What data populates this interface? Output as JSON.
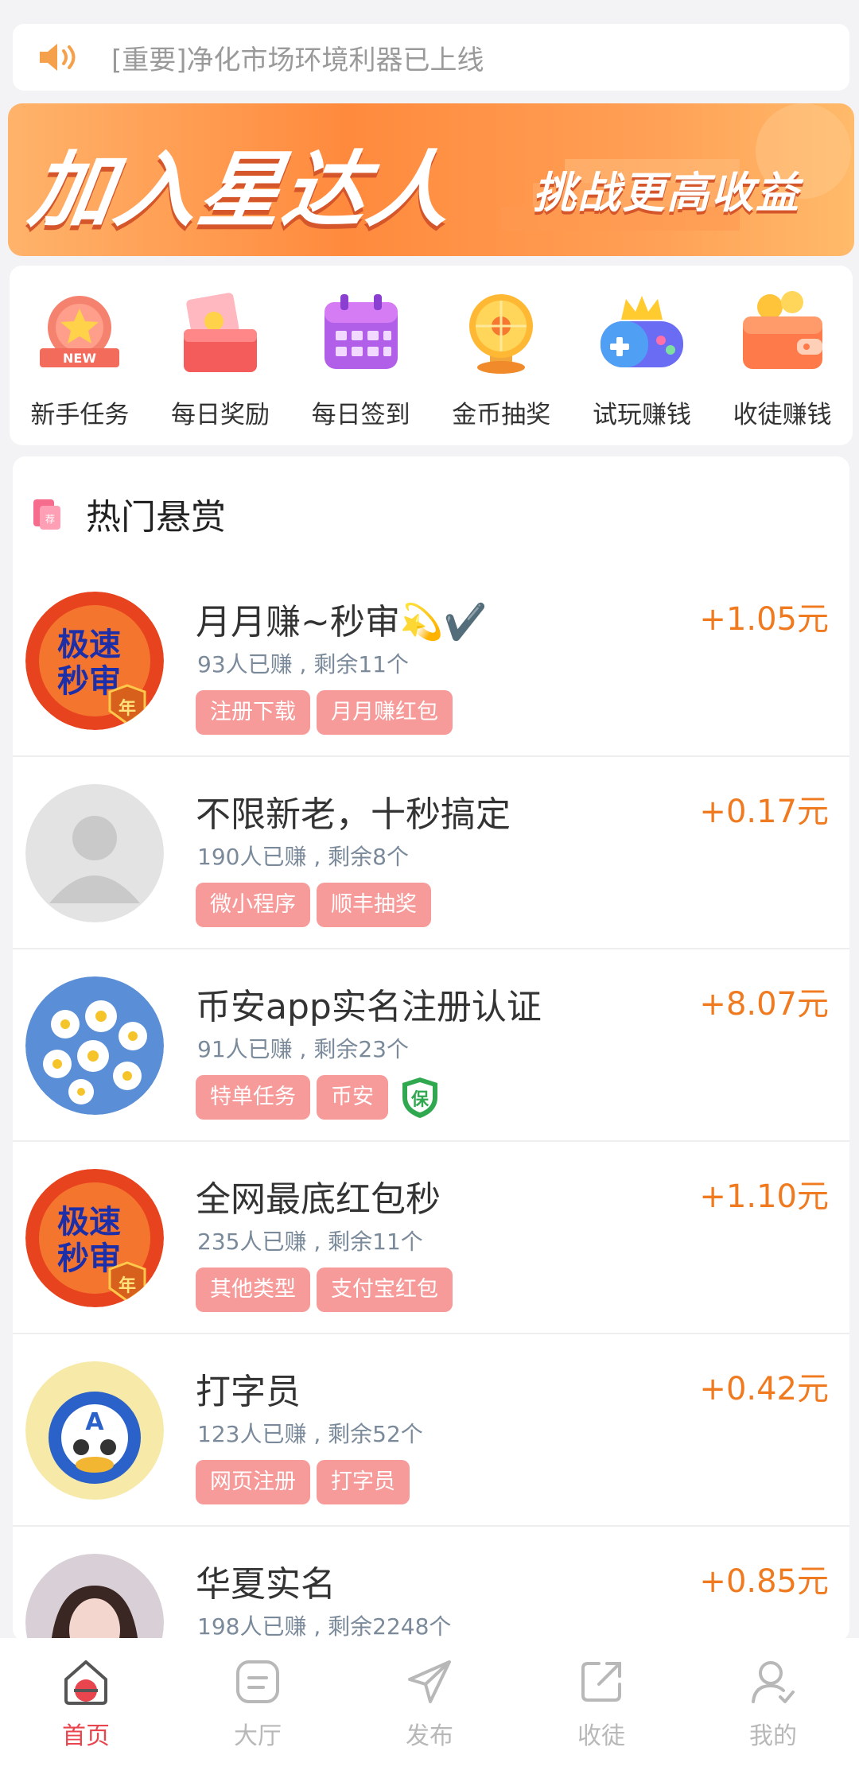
{
  "notice": {
    "text": "[重要]净化市场环境利器已上线",
    "icon": "speaker-icon"
  },
  "banner": {
    "main": "加入星达人",
    "sub": "挑战更高收益"
  },
  "quick_actions": [
    {
      "label": "新手任务",
      "icon": "new-badge-icon",
      "badge": "NEW"
    },
    {
      "label": "每日奖励",
      "icon": "gift-envelope-icon"
    },
    {
      "label": "每日签到",
      "icon": "calendar-icon"
    },
    {
      "label": "金币抽奖",
      "icon": "lottery-wheel-icon"
    },
    {
      "label": "试玩赚钱",
      "icon": "gamepad-icon"
    },
    {
      "label": "收徒赚钱",
      "icon": "wallet-icon"
    }
  ],
  "hot_section": {
    "title": "热门悬赏",
    "icon": "recommend-icon"
  },
  "tasks": [
    {
      "title": "月月赚~秒审💫✔️",
      "stats": "93人已赚 , 剩余11个",
      "reward": "+1.05元",
      "tags": [
        "注册下载",
        "月月赚红包"
      ],
      "avatar": "speed-badge"
    },
    {
      "title": "不限新老，十秒搞定",
      "stats": "190人已赚 , 剩余8个",
      "reward": "+0.17元",
      "tags": [
        "微小程序",
        "顺丰抽奖"
      ],
      "avatar": "default"
    },
    {
      "title": "币安app实名注册认证",
      "stats": "91人已赚 , 剩余23个",
      "reward": "+8.07元",
      "tags": [
        "特单任务",
        "币安"
      ],
      "avatar": "flowers",
      "guarantee": "保"
    },
    {
      "title": "全网最底红包秒",
      "stats": "235人已赚 , 剩余11个",
      "reward": "+1.10元",
      "tags": [
        "其他类型",
        "支付宝红包"
      ],
      "avatar": "speed-badge"
    },
    {
      "title": "打字员",
      "stats": "123人已赚 , 剩余52个",
      "reward": "+0.42元",
      "tags": [
        "网页注册",
        "打字员"
      ],
      "avatar": "cartoon"
    },
    {
      "title": "华夏实名",
      "stats": "198人已赚 , 剩余2248个",
      "reward": "+0.85元",
      "tags": [],
      "avatar": "portrait"
    }
  ],
  "speed_badge": {
    "line1": "极速",
    "line2": "秒审",
    "seal": "年"
  },
  "tabbar": [
    {
      "label": "首页",
      "icon": "home-icon",
      "active": true
    },
    {
      "label": "大厅",
      "icon": "hall-icon"
    },
    {
      "label": "发布",
      "icon": "publish-icon"
    },
    {
      "label": "收徒",
      "icon": "share-icon"
    },
    {
      "label": "我的",
      "icon": "profile-icon"
    }
  ],
  "colors": {
    "accent": "#f07a1f",
    "tag": "#f69a9a",
    "active_tab": "#e9454f"
  }
}
